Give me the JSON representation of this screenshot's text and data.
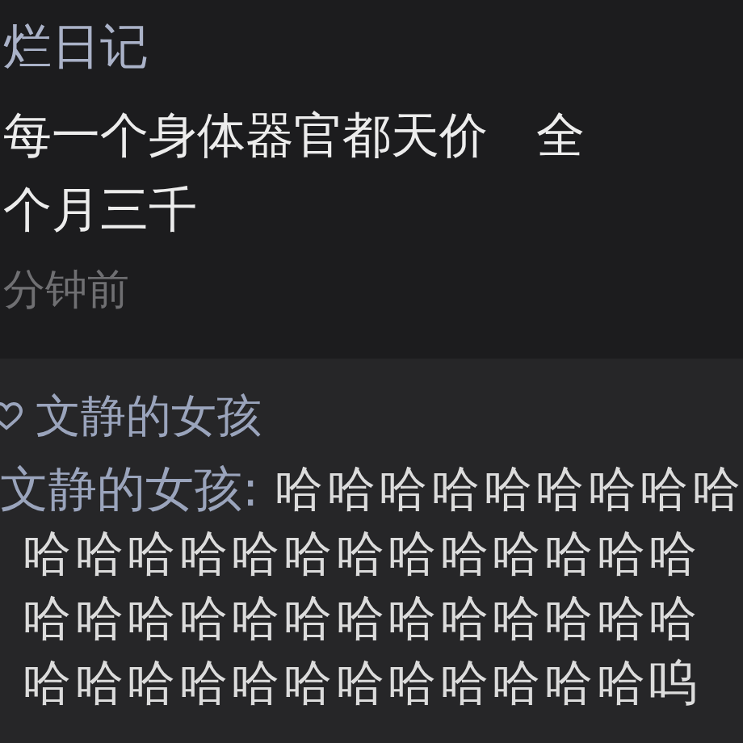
{
  "post": {
    "title": "烂日记",
    "body_lines": [
      "每一个身体器官都天价　全",
      "个月三千"
    ],
    "time": "分钟前"
  },
  "likes": {
    "names": "文静的女孩"
  },
  "comment": {
    "author": "文静的女孩:",
    "lines": [
      "哈哈哈哈哈哈哈哈哈",
      "哈哈哈哈哈哈哈哈哈哈哈哈哈",
      "哈哈哈哈哈哈哈哈哈哈哈哈哈",
      "哈哈哈哈哈哈哈哈哈哈哈哈呜"
    ]
  }
}
